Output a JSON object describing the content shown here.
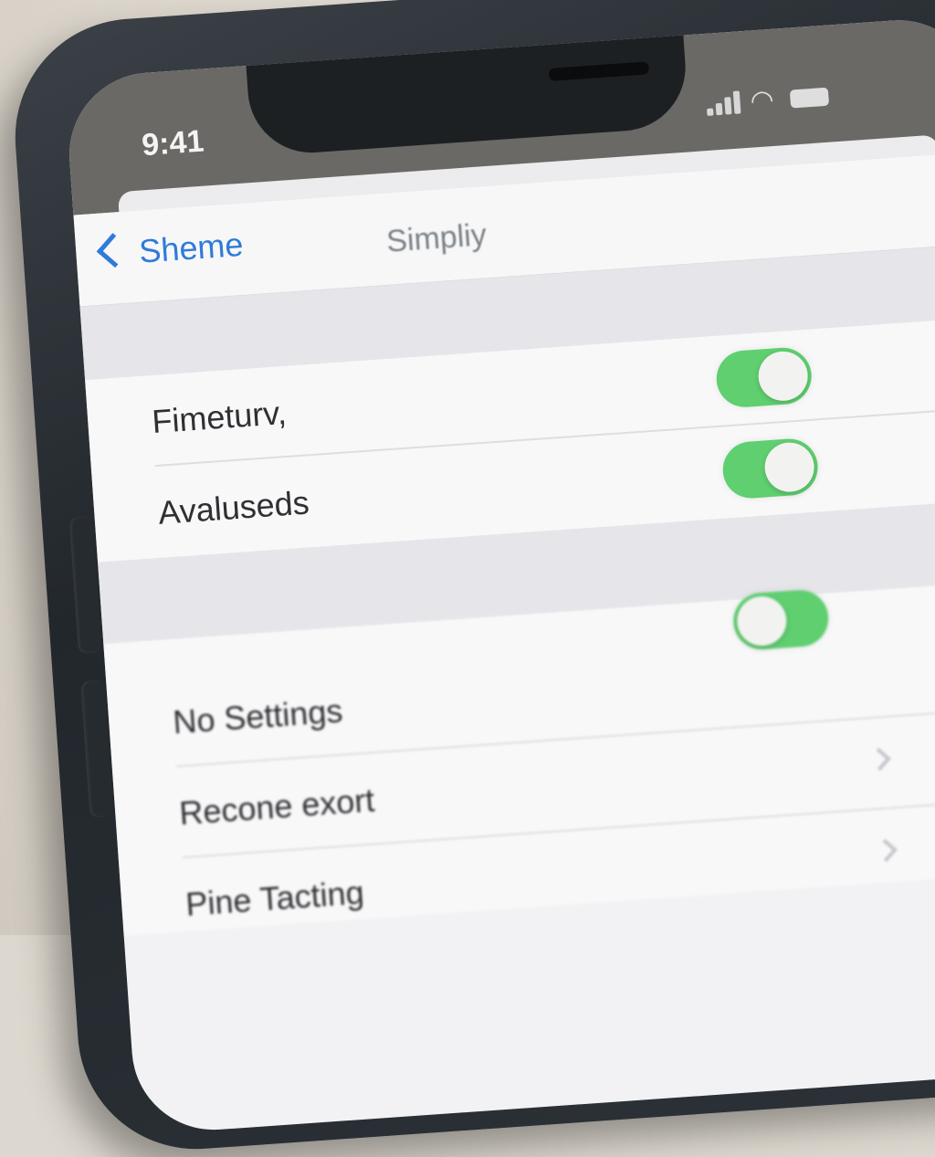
{
  "status_bar": {
    "time": "9:41",
    "icons": [
      "signal-icon",
      "wifi-icon",
      "battery-icon"
    ]
  },
  "nav": {
    "back_label": "Sheme",
    "title": "Simpliy",
    "accent_color": "#2f7bd9"
  },
  "groups": [
    {
      "rows": [
        {
          "label": "Fimeturv,",
          "control": "toggle",
          "state": "on"
        },
        {
          "label": "Avaluseds",
          "control": "toggle",
          "state": "on"
        }
      ]
    },
    {
      "rows": [
        {
          "label": "No Settings",
          "control": "toggle",
          "state": "on"
        },
        {
          "label": "Recone exort",
          "control": "chevron"
        },
        {
          "label": "Pine Tacting",
          "control": "chevron"
        }
      ]
    }
  ],
  "colors": {
    "toggle_on": "#5fcf6f",
    "chevron": "#c7c7cc"
  }
}
